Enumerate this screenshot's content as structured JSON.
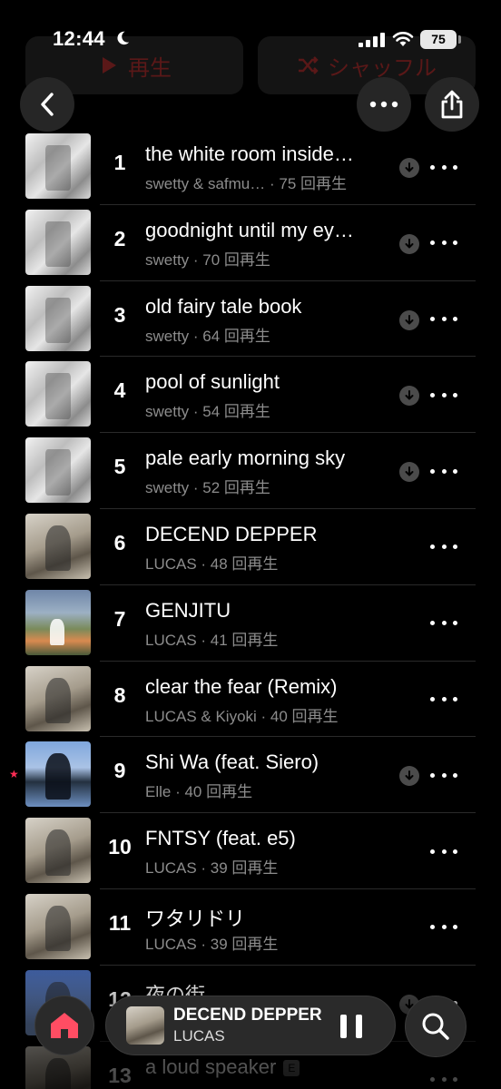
{
  "status": {
    "time": "12:44",
    "battery": "75"
  },
  "header": {
    "play_label": "再生",
    "shuffle_label": "シャッフル"
  },
  "colors": {
    "accent": "#ff2d55",
    "background": "#000000",
    "secondary_text": "#8c8c8c"
  },
  "tracks": [
    {
      "num": "1",
      "title": "the white room inside…",
      "subtitle": "swetty & safmu… · 75 回再生",
      "art": "a",
      "downloaded": true,
      "starred": false
    },
    {
      "num": "2",
      "title": "goodnight until my ey…",
      "subtitle": "swetty · 70 回再生",
      "art": "a",
      "downloaded": true,
      "starred": false
    },
    {
      "num": "3",
      "title": "old fairy tale book",
      "subtitle": "swetty · 64 回再生",
      "art": "a",
      "downloaded": true,
      "starred": false
    },
    {
      "num": "4",
      "title": "pool of sunlight",
      "subtitle": "swetty · 54 回再生",
      "art": "a",
      "downloaded": true,
      "starred": false
    },
    {
      "num": "5",
      "title": "pale early morning sky",
      "subtitle": "swetty · 52 回再生",
      "art": "a",
      "downloaded": true,
      "starred": false
    },
    {
      "num": "6",
      "title": "DECEND DEPPER",
      "subtitle": "LUCAS · 48 回再生",
      "art": "b",
      "downloaded": false,
      "starred": false
    },
    {
      "num": "7",
      "title": "GENJITU",
      "subtitle": "LUCAS · 41 回再生",
      "art": "c",
      "downloaded": false,
      "starred": false
    },
    {
      "num": "8",
      "title": "clear the fear (Remix)",
      "subtitle": "LUCAS & Kiyoki · 40 回再生",
      "art": "b",
      "downloaded": false,
      "starred": false
    },
    {
      "num": "9",
      "title": "Shi Wa (feat. Siero)",
      "subtitle": "Elle · 40 回再生",
      "art": "d",
      "downloaded": true,
      "starred": true
    },
    {
      "num": "10",
      "title": "FNTSY (feat. e5)",
      "subtitle": "LUCAS · 39 回再生",
      "art": "b",
      "downloaded": false,
      "starred": false
    },
    {
      "num": "11",
      "title": "ワタリドリ",
      "subtitle": "LUCAS · 39 回再生",
      "art": "b",
      "downloaded": false,
      "starred": false
    },
    {
      "num": "12",
      "title": "夜の街",
      "subtitle": "",
      "art": "e",
      "downloaded": true,
      "starred": false
    },
    {
      "num": "13",
      "title": "a loud speaker",
      "subtitle": "",
      "art": "b",
      "downloaded": false,
      "starred": false,
      "explicit": "E"
    }
  ],
  "mini_player": {
    "title": "DECEND DEPPER",
    "artist": "LUCAS"
  },
  "icons": {
    "back": "chevron-left-icon",
    "more": "ellipsis-icon",
    "share": "share-icon",
    "home": "home-icon",
    "search": "search-icon",
    "pause": "pause-icon",
    "download": "download-icon"
  }
}
